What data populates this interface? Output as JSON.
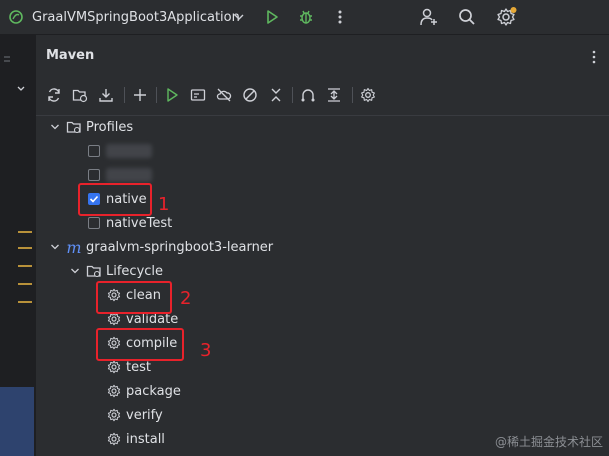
{
  "titlebar": {
    "app_title": "GraalVMSpringBoot3Application"
  },
  "panel": {
    "title": "Maven"
  },
  "tree": {
    "profiles_label": "Profiles",
    "profiles": [
      {
        "label": "",
        "checked": false,
        "obscured": true
      },
      {
        "label": "",
        "checked": false,
        "obscured": true
      },
      {
        "label": "native",
        "checked": true
      },
      {
        "label": "nativeTest",
        "checked": false
      }
    ],
    "project_label": "graalvm-springboot3-learner",
    "lifecycle_label": "Lifecycle",
    "lifecycle": [
      "clean",
      "validate",
      "compile",
      "test",
      "package",
      "verify",
      "install"
    ]
  },
  "annotations": [
    "1",
    "2",
    "3"
  ],
  "watermark": "@稀土掘金技术社区",
  "colors": {
    "accent": "#3574f0",
    "annotation": "#e8222b",
    "run": "#5fb85f",
    "background": "#2b2d30"
  }
}
